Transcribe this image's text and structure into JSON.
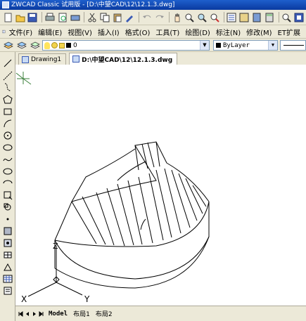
{
  "window": {
    "title": "ZWCAD Classic 试用版 - [D:\\中望CAD\\12\\12.1.3.dwg]"
  },
  "toolbar": {
    "icons": [
      "new-icon",
      "open-icon",
      "save-icon",
      "print-icon",
      "print-preview-icon",
      "plot-icon",
      "cut-icon",
      "copy-icon",
      "paste-icon",
      "match-properties-icon",
      "undo-icon",
      "redo-icon",
      "pan-icon",
      "zoom-realtime-icon",
      "zoom-window-icon",
      "zoom-previous-icon",
      "properties-icon",
      "design-center-icon",
      "tool-palette-icon",
      "calculator-icon",
      "help-icon",
      "extra-icon"
    ]
  },
  "menu": {
    "items": [
      "文件(F)",
      "编辑(E)",
      "视图(V)",
      "插入(I)",
      "格式(O)",
      "工具(T)",
      "绘图(D)",
      "标注(N)",
      "修改(M)",
      "ET扩展"
    ]
  },
  "layers": {
    "current_layer": "0",
    "color_label": "ByLayer"
  },
  "doc_tabs": [
    "Drawing1",
    "D:\\中望CAD\\12\\12.1.3.dwg"
  ],
  "canvas": {
    "axis_x": "X",
    "axis_y": "Y",
    "axis_z": "Z"
  },
  "layout_tabs": [
    "Model",
    "布局1",
    "布局2"
  ],
  "colors": {
    "title_bar": "#1e5fcc",
    "chrome": "#ece9d8",
    "canvas": "#ffffff"
  }
}
